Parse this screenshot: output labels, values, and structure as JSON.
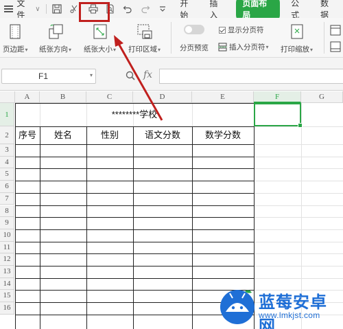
{
  "menubar": {
    "file_label": "文件",
    "tabs": [
      {
        "label": "开始",
        "active": false
      },
      {
        "label": "插入",
        "active": false
      },
      {
        "label": "页面布局",
        "active": true
      },
      {
        "label": "公式",
        "active": false
      },
      {
        "label": "数据",
        "active": false
      }
    ],
    "quick_access_icons": [
      "save-icon",
      "scissors-icon",
      "print-icon",
      "print-preview-icon",
      "undo-icon",
      "redo-icon",
      "more-dropdown-icon"
    ]
  },
  "ribbon": {
    "margins": "页边距",
    "orientation": "纸张方向",
    "size": "纸张大小",
    "print_area": "打印区域",
    "page_break_preview": "分页预览",
    "show_page_breaks": "显示分页符",
    "insert_page_break": "插入分页符",
    "print_scale": "打印缩放"
  },
  "formula_bar": {
    "cell_ref": "F1",
    "fx_label": "fx",
    "formula": ""
  },
  "sheet": {
    "columns": [
      "A",
      "B",
      "C",
      "D",
      "E",
      "F",
      "G"
    ],
    "selected_column": "F",
    "rows": [
      "1",
      "2",
      "3",
      "4",
      "5",
      "6",
      "7",
      "8",
      "9",
      "10",
      "11",
      "12",
      "13",
      "14",
      "15",
      "16"
    ],
    "selected_row": "1",
    "title": "********学校",
    "headers": [
      "序号",
      "姓名",
      "性别",
      "语文分数",
      "数学分数"
    ]
  },
  "colors": {
    "accent": "#2aa646",
    "annotation_red": "#c0201e",
    "watermark_blue": "#1f6fd6"
  },
  "watermark": {
    "name": "蓝莓安卓网",
    "url": "www.lmkjst.com"
  }
}
